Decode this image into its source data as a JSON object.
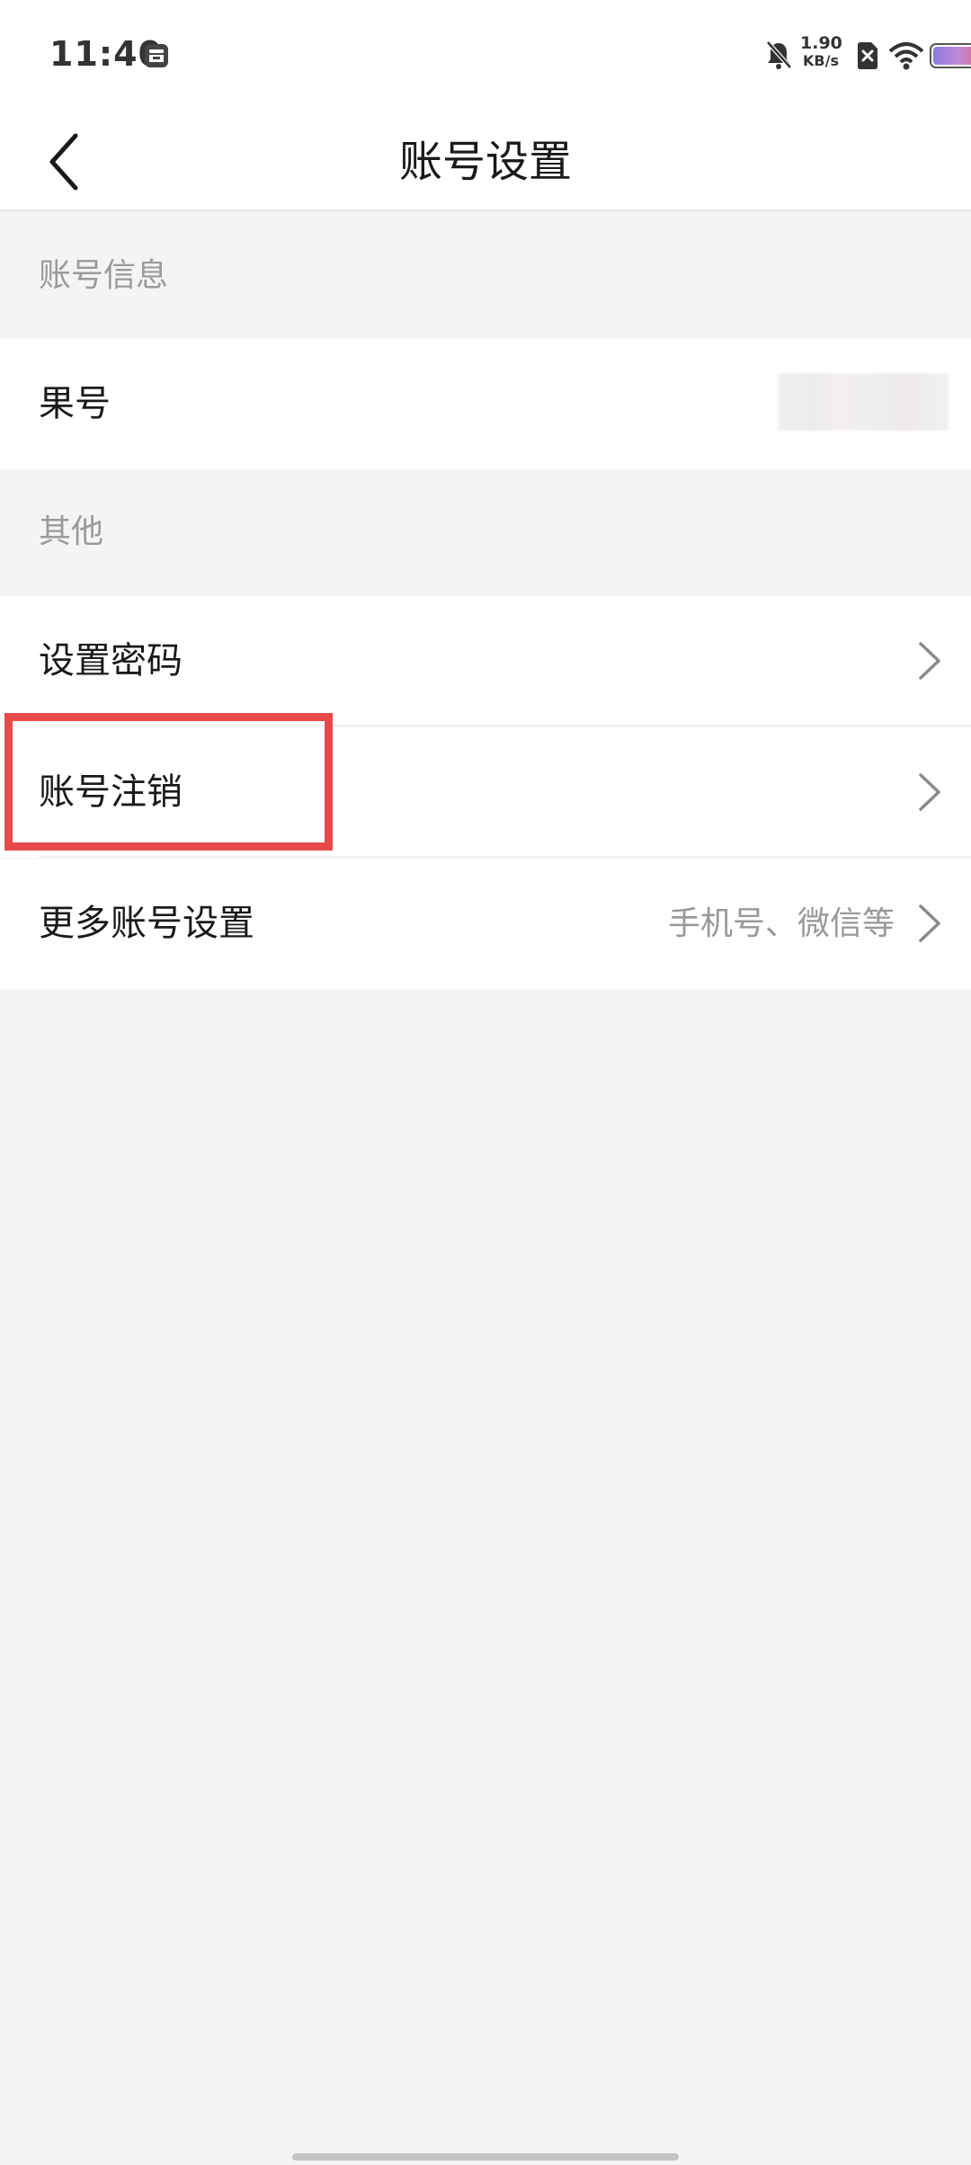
{
  "status_bar": {
    "time": "11:40",
    "net_speed_value": "1.90",
    "net_speed_unit": "KB/s",
    "icons": [
      "app-notification-icon",
      "bell-muted-icon",
      "sim-disabled-icon",
      "wifi-icon",
      "battery-icon"
    ]
  },
  "header": {
    "title": "账号设置",
    "back_icon": "chevron-left-icon"
  },
  "sections": {
    "account_info": {
      "label": "账号信息",
      "guohao_label": "果号"
    },
    "other": {
      "label": "其他",
      "set_password_label": "设置密码",
      "deactivate_label": "账号注销",
      "more_settings_label": "更多账号设置",
      "more_settings_value": "手机号、微信等"
    }
  },
  "colors": {
    "background": "#f4f4f4",
    "highlight": "#e84a4a",
    "secondary_text": "#999999"
  }
}
